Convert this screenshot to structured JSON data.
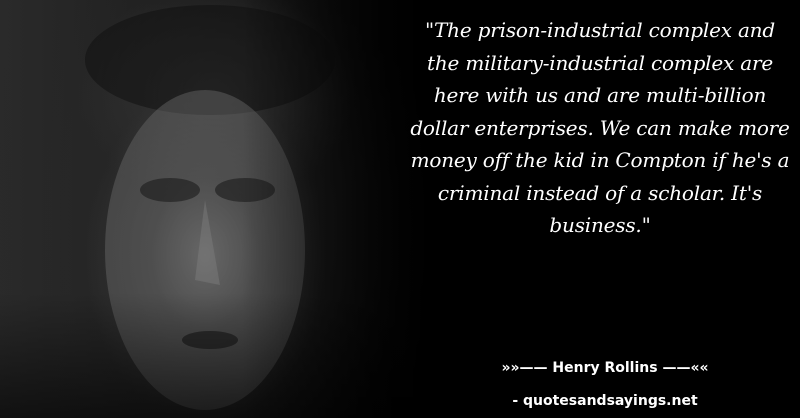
{
  "quote": {
    "text": "\"The prison-industrial complex and the military-industrial complex are here with us and are multi-billion dollar enterprises. We can make more money off the kid in Compton if he's a criminal instead of a scholar. It's business.\""
  },
  "attribution": {
    "author_line": "»»—— Henry Rollins ——««",
    "site": "- quotesandsayings.net"
  },
  "colors": {
    "background": "#000000",
    "text": "#ffffff"
  }
}
